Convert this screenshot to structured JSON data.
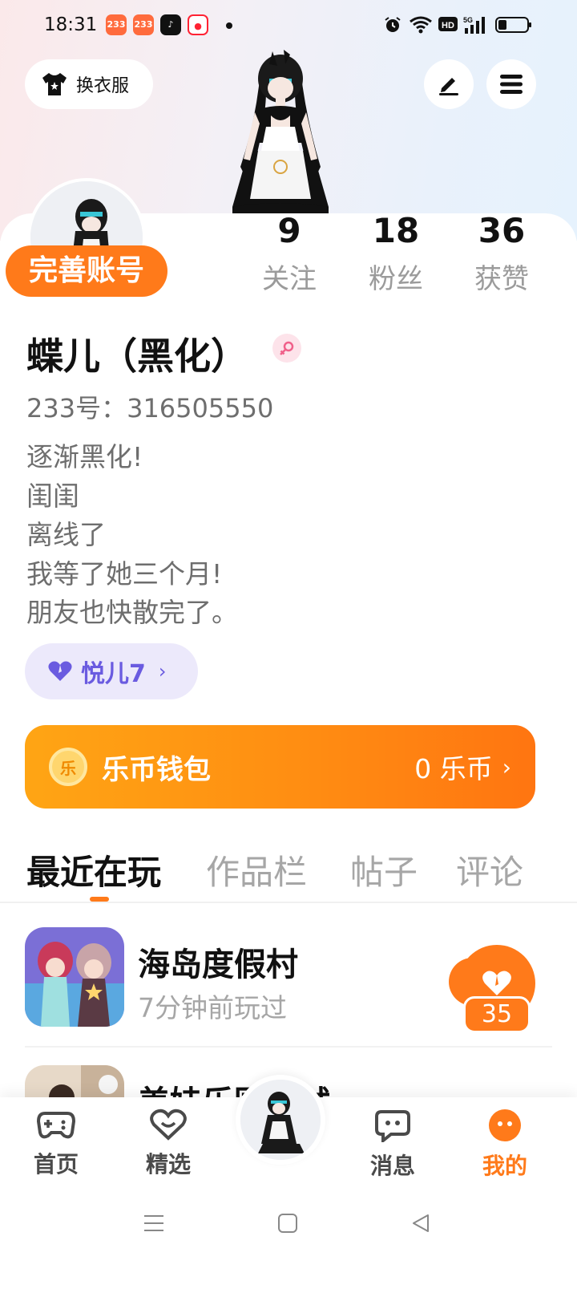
{
  "status_bar": {
    "time": "18:31",
    "apps": [
      "app-233-icon",
      "app-233-icon",
      "tiktok-icon",
      "app-red-icon"
    ],
    "right_icons": [
      "alarm-icon",
      "wifi-icon",
      "hd-icon",
      "signal-5g-icon",
      "battery-icon"
    ]
  },
  "header": {
    "dress_label": "换衣服",
    "edit_icon": "pen-icon",
    "menu_icon": "menu-icon"
  },
  "profile": {
    "complete_label": "完善账号",
    "stats": [
      {
        "value": "9",
        "label": "关注"
      },
      {
        "value": "18",
        "label": "粉丝"
      },
      {
        "value": "36",
        "label": "获赞"
      }
    ],
    "nickname": "蝶儿（黑化）",
    "uid": "233号：316505550",
    "bio": [
      "逐渐黑化!",
      "闺闺",
      "离线了",
      "我等了她三个月!",
      "朋友也快散完了。"
    ],
    "tag": {
      "label": "悦儿7",
      "icon": "heart-icon"
    }
  },
  "wallet": {
    "coin_char": "乐",
    "title": "乐币钱包",
    "amount": "0 乐币"
  },
  "tabs": [
    "最近在玩",
    "作品栏",
    "帖子",
    "评论"
  ],
  "games": [
    {
      "title": "海岛度假村",
      "subtitle": "7分钟前玩过",
      "likes": "35"
    },
    {
      "title": "美娃乐园测试",
      "subtitle": "",
      "likes": ""
    }
  ],
  "bottom_nav": [
    {
      "label": "首页",
      "icon": "gamepad-icon"
    },
    {
      "label": "精选",
      "icon": "heart-outline-icon"
    },
    {
      "label": "消息",
      "icon": "message-icon"
    },
    {
      "label": "我的",
      "icon": "profile-dots-icon"
    }
  ],
  "colors": {
    "accent": "#ff7a1a",
    "tag_bg": "#ece9fb",
    "tag_text": "#6a5be0"
  }
}
